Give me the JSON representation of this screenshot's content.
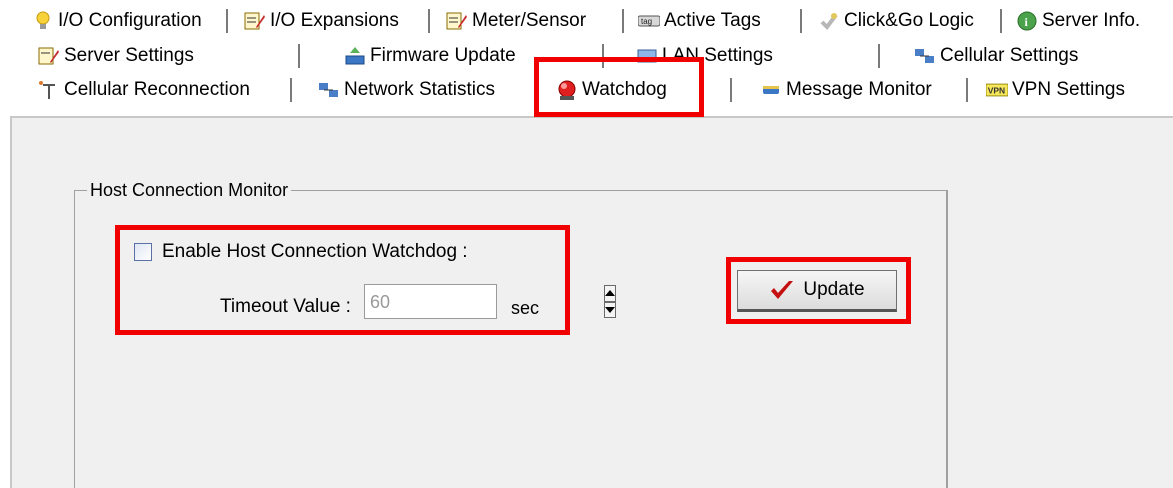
{
  "tabs": {
    "row1": [
      {
        "label": "I/O Configuration",
        "icon": "lightbulb-icon"
      },
      {
        "label": "I/O Expansions",
        "icon": "io-edit-icon"
      },
      {
        "label": "Meter/Sensor",
        "icon": "meter-edit-icon"
      },
      {
        "label": "Active Tags",
        "icon": "active-tags-icon"
      },
      {
        "label": "Click&Go Logic",
        "icon": "click-go-icon"
      },
      {
        "label": "Server Info.",
        "icon": "info-icon"
      }
    ],
    "row2": [
      {
        "label": "Server Settings",
        "icon": "server-edit-icon"
      },
      {
        "label": "Firmware Update",
        "icon": "firmware-icon"
      },
      {
        "label": "LAN Settings",
        "icon": "lan-icon"
      },
      {
        "label": "Cellular Settings",
        "icon": "cellular-network-icon"
      }
    ],
    "row3": [
      {
        "label": "Cellular Reconnection",
        "icon": "antenna-icon"
      },
      {
        "label": "Network Statistics",
        "icon": "network-icon"
      },
      {
        "label": "Watchdog",
        "icon": "red-siren-icon"
      },
      {
        "label": "Message Monitor",
        "icon": "message-icon"
      },
      {
        "label": "VPN Settings",
        "icon": "vpn-icon"
      }
    ]
  },
  "group": {
    "title": "Host Connection Monitor",
    "enable_label": "Enable Host Connection Watchdog :",
    "enable_checked": false,
    "timeout_label": "Timeout Value :",
    "timeout_value": "60",
    "timeout_unit": "sec"
  },
  "update_button": {
    "label": "Update",
    "icon": "red-checkmark-icon"
  },
  "colors": {
    "highlight": "#f00000",
    "panel": "#f0f0f0"
  }
}
